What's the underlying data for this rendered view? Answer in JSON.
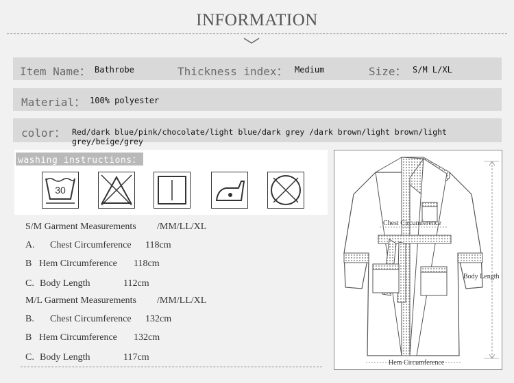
{
  "header": {
    "title": "INFORMATION"
  },
  "product": {
    "item_name_label": "Item Name：",
    "item_name_value": "Bathrobe",
    "thickness_label": "Thickness index：",
    "thickness_value": "Medium",
    "size_label": "Size：",
    "size_value": "S/M  L/XL",
    "material_label": "Material：",
    "material_value": "100% polyester",
    "color_label": "color：",
    "color_value": "Red/dark blue/pink/chocolate/light blue/dark grey /dark brown/light brown/light grey/beige/grey"
  },
  "washing": {
    "title": "washing instructions：",
    "icons": [
      "wash-30-icon",
      "do-not-bleach-icon",
      "tumble-dry-icon",
      "iron-low-icon",
      "do-not-dry-clean-icon"
    ],
    "wash_temp": "30"
  },
  "measurements": {
    "sm_heading": "S/M Garment Measurements",
    "sm_sizes": "/MM/LL/XL",
    "sm_rows": [
      {
        "marker": "A.",
        "label": "Chest Circumference",
        "value": "118cm"
      },
      {
        "marker": "B",
        "label": "Hem Circumference",
        "value": "118cm"
      },
      {
        "marker": "C.",
        "label": "Body Length",
        "value": "112cm"
      }
    ],
    "ml_heading": "M/L Garment Measurements",
    "ml_sizes": "/MM/LL/XL",
    "ml_rows": [
      {
        "marker": "B.",
        "label": "Chest Circumference",
        "value": "132cm"
      },
      {
        "marker": "B",
        "label": "Hem Circumference",
        "value": "132cm"
      },
      {
        "marker": "C.",
        "label": "Body Length",
        "value": "117cm"
      }
    ]
  },
  "diagram": {
    "chest_label": "Chest Circumference",
    "body_length_label": "Body Length",
    "hem_label": "Hem Circumference"
  }
}
